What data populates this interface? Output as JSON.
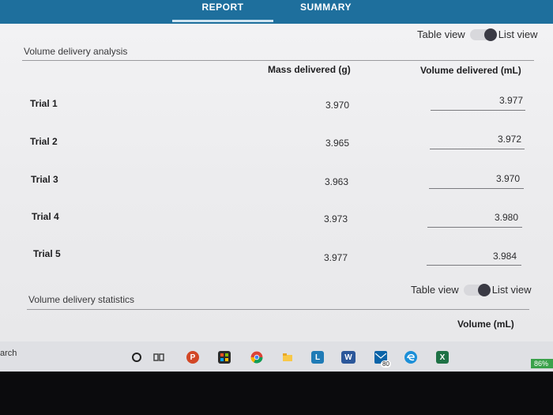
{
  "tabs": [
    {
      "label": "REPORT"
    },
    {
      "label": "SUMMARY"
    }
  ],
  "delivery": {
    "section_title": "Volume delivery analysis",
    "toggle": {
      "left_label": "Table view",
      "right_label": "List view"
    },
    "columns": {
      "mass": "Mass delivered (g)",
      "volume": "Volume delivered (mL)"
    },
    "rows": [
      {
        "label": "Trial 1",
        "mass": "3.970",
        "volume": "3.977"
      },
      {
        "label": "Trial 2",
        "mass": "3.965",
        "volume": "3.972"
      },
      {
        "label": "Trial 3",
        "mass": "3.963",
        "volume": "3.970"
      },
      {
        "label": "Trial 4",
        "mass": "3.973",
        "volume": "3.980"
      },
      {
        "label": "Trial 5",
        "mass": "3.977",
        "volume": "3.984"
      }
    ]
  },
  "statistics": {
    "section_title": "Volume delivery statistics",
    "toggle": {
      "left_label": "Table view",
      "right_label": "List view"
    },
    "columns": {
      "volume": "Volume (mL)"
    }
  },
  "taskbar": {
    "search_text": "arch",
    "battery": "86%",
    "mail_count": "80",
    "icons": [
      "cortana-icon",
      "task-view-icon",
      "powerpoint-icon",
      "store-icon",
      "chrome-icon",
      "file-explorer-icon",
      "lync-icon",
      "word-icon",
      "mail-icon",
      "edge-icon",
      "excel-icon"
    ]
  },
  "colors": {
    "tab_bar": "#1e6f9d",
    "page_bg": "#ececee",
    "taskbar_bg": "#dfe0e4",
    "battery": "#3aa14a"
  }
}
